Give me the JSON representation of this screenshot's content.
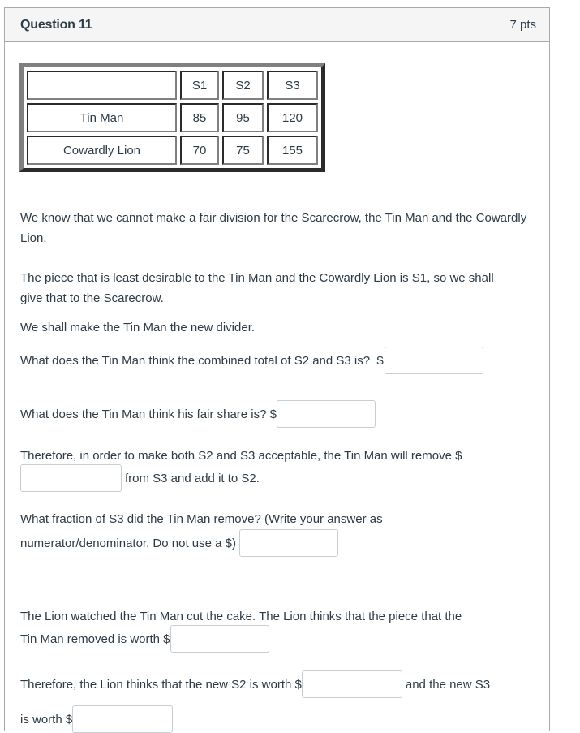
{
  "question": {
    "title": "Question 11",
    "points": "7 pts"
  },
  "table": {
    "headers": [
      "",
      "S1",
      "S2",
      "S3"
    ],
    "rows": [
      {
        "name": "Tin Man",
        "values": [
          "85",
          "95",
          "120"
        ]
      },
      {
        "name": "Cowardly Lion",
        "values": [
          "70",
          "75",
          "155"
        ]
      }
    ]
  },
  "text": {
    "p1": "We know that we cannot make a fair division for the Scarecrow, the Tin Man and the Cowardly Lion.",
    "p2": "The piece that is least desirable to the Tin Man and the Cowardly Lion is S1, so we shall give that to the Scarecrow.",
    "p3": "We shall make the Tin Man the new divider.",
    "q1": "What does the Tin Man think the combined total of S2 and S3 is?  $",
    "q2": "What does the Tin Man think his fair share is? $",
    "q3_before": "Therefore, in order to make both S2 and S3 acceptable, the Tin Man will remove $",
    "q3_after": "from S3 and add it to S2.",
    "q4_line1": "What fraction of S3 did the Tin Man remove? (Write your answer as",
    "q4_line2": "numerator/denominator. Do not use a $)",
    "q5_line1": "The Lion watched the Tin Man cut the cake.  The Lion thinks that the piece that the",
    "q5_line2": "Tin Man removed is worth $",
    "q6_before": "Therefore, the Lion thinks that the new S2 is worth $",
    "q6_middle": "and the new S3",
    "q6_line2": "is worth $"
  },
  "inputs": {
    "combined_total": "",
    "fair_share": "",
    "amount_removed": "",
    "fraction_removed": "",
    "lion_removed_value": "",
    "lion_new_s2": "",
    "lion_new_s3": ""
  }
}
